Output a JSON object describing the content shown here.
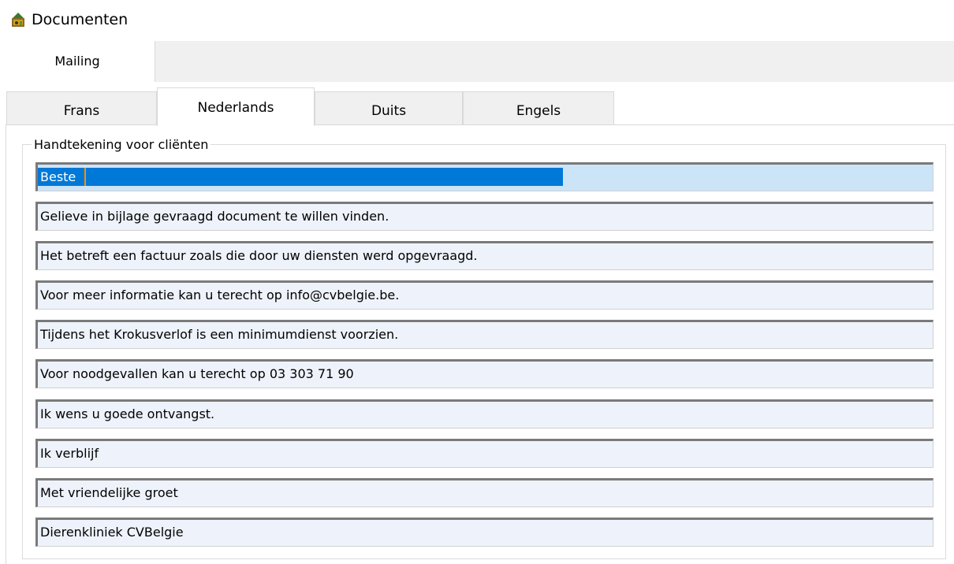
{
  "window": {
    "title": "Documenten",
    "icon": "app-icon"
  },
  "outer_tabs": [
    {
      "label": "Mailing",
      "active": true
    }
  ],
  "inner_tabs": [
    {
      "label": "Frans",
      "active": false
    },
    {
      "label": "Nederlands",
      "active": true
    },
    {
      "label": "Duits",
      "active": false
    },
    {
      "label": "Engels",
      "active": false
    }
  ],
  "group": {
    "label": "Handtekening voor cliënten"
  },
  "fields": [
    {
      "value": "Beste",
      "focused": true,
      "selected": true
    },
    {
      "value": "Gelieve in bijlage gevraagd document te willen vinden."
    },
    {
      "value": "Het betreft een factuur zoals die door uw diensten werd opgevraagd."
    },
    {
      "value": "Voor meer informatie kan u terecht op info@cvbelgie.be."
    },
    {
      "value": "Tijdens het Krokusverlof is een minimumdienst voorzien."
    },
    {
      "value": "Voor noodgevallen kan u terecht op 03 303 71 90"
    },
    {
      "value": "Ik wens u goede ontvangst."
    },
    {
      "value": "Ik verblijf"
    },
    {
      "value": "Met vriendelijke groet"
    },
    {
      "value": "Dierenkliniek CVBelgie"
    }
  ],
  "colors": {
    "selection": "#0078d7",
    "focus_background": "#cce4f7",
    "field_background": "#eef3fb",
    "caret": "#ff8c00"
  }
}
